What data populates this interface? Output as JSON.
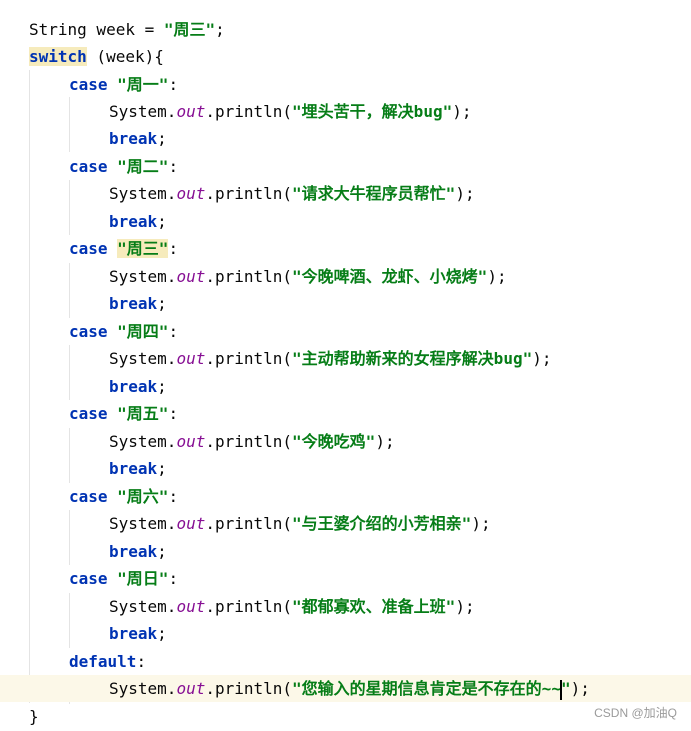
{
  "code": {
    "decl": {
      "type": "String",
      "var": " week = ",
      "value": "\"周三\"",
      "end": ";"
    },
    "switch": {
      "keyword": "switch",
      "expr": " (week){"
    },
    "case_keyword": "case",
    "break_keyword": "break",
    "break_semicolon": ";",
    "system": "System.",
    "out": "out",
    "println_open": ".println(",
    "println_close": ");",
    "cases": [
      {
        "label": "\"周一\"",
        "colon": ":",
        "message": "\"埋头苦干，解决bug\""
      },
      {
        "label": "\"周二\"",
        "colon": ":",
        "message": "\"请求大牛程序员帮忙\""
      },
      {
        "label": "\"周三\"",
        "colon": ":",
        "message": "\"今晚啤酒、龙虾、小烧烤\""
      },
      {
        "label": "\"周四\"",
        "colon": ":",
        "message": "\"主动帮助新来的女程序解决bug\""
      },
      {
        "label": "\"周五\"",
        "colon": ":",
        "message": "\"今晚吃鸡\""
      },
      {
        "label": "\"周六\"",
        "colon": ":",
        "message": "\"与王婆介绍的小芳相亲\""
      },
      {
        "label": "\"周日\"",
        "colon": ":",
        "message": "\"都郁寡欢、准备上班\""
      }
    ],
    "default": {
      "keyword": "default",
      "colon": ":",
      "message_before_caret": "\"您输入的星期信息肯定是不存在的~~",
      "message_after_caret": "\""
    },
    "closing": "}"
  },
  "watermark": "CSDN @加油Q",
  "colors": {
    "keyword": "#0033b3",
    "string": "#067d17",
    "field": "#871094",
    "current_line": "#fcf8e8",
    "match_highlight": "#f6ebbc"
  }
}
